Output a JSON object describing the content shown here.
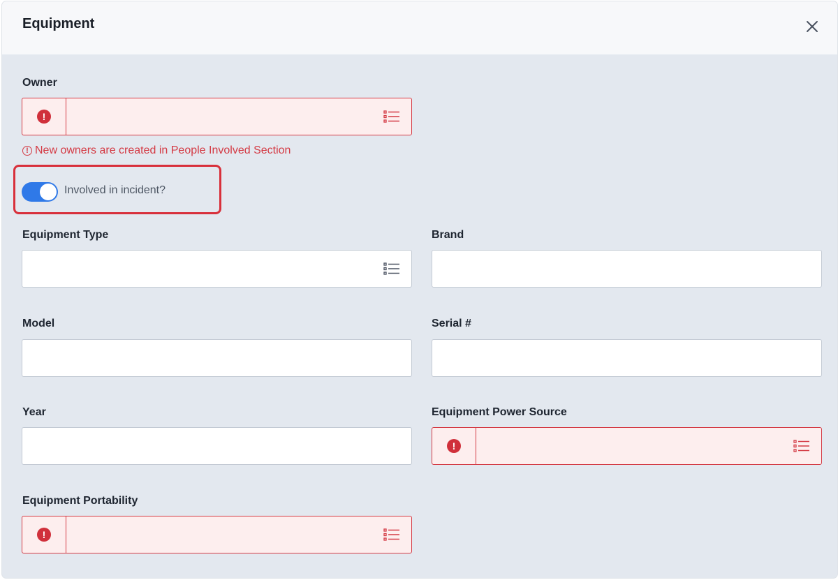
{
  "dialog": {
    "title": "Equipment",
    "close_icon": "close-icon"
  },
  "owner": {
    "label": "Owner",
    "value": "",
    "error_icon": "exclamation-circle-icon",
    "picker_icon": "list-icon",
    "hint": "New owners are created in People Involved Section",
    "hint_icon": "exclamation-circle-outline-icon"
  },
  "involved_toggle": {
    "label": "Involved in incident?",
    "checked": true
  },
  "fields": {
    "equipment_type": {
      "label": "Equipment Type",
      "value": "",
      "picker_icon": "list-icon"
    },
    "brand": {
      "label": "Brand",
      "value": ""
    },
    "model": {
      "label": "Model",
      "value": ""
    },
    "serial": {
      "label": "Serial #",
      "value": ""
    },
    "year": {
      "label": "Year",
      "value": ""
    },
    "power_source": {
      "label": "Equipment Power Source",
      "value": "",
      "error_icon": "exclamation-circle-icon",
      "picker_icon": "list-icon"
    },
    "portability": {
      "label": "Equipment Portability",
      "value": "",
      "error_icon": "exclamation-circle-icon",
      "picker_icon": "list-icon"
    }
  },
  "colors": {
    "error": "#d43a44",
    "accent": "#2f79e8",
    "background": "#e3e8ef"
  }
}
